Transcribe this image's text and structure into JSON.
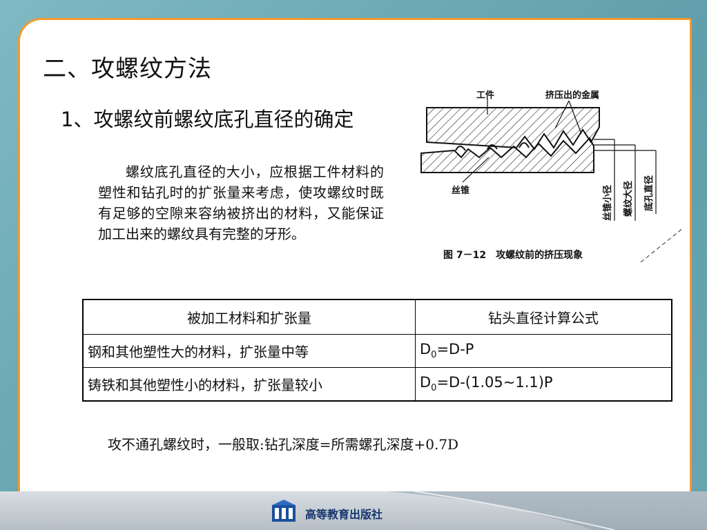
{
  "slide": {
    "title": "二、攻螺纹方法",
    "subtitle": "1、攻螺纹前螺纹底孔直径的确定",
    "paragraph": "螺纹底孔直径的大小，应根据工件材料的塑性和钻孔时的扩张量来考虑，使攻螺纹时既有足够的空隙来容纳被挤出的材料，又能保证加工出来的螺纹具有完整的牙形。",
    "note": "攻不通孔螺纹时，一般取:钻孔深度=所需螺孔深度+0.7D"
  },
  "figure": {
    "label_workpiece": "工件",
    "label_extruded": "挤压出的金属",
    "label_tap": "丝锥",
    "label_tap_minor": "丝锥小径",
    "label_thread_major": "螺纹大径",
    "label_hole": "底孔直径",
    "caption": "图 7－12　攻螺纹前的挤压现象"
  },
  "table": {
    "headers": [
      "被加工材料和扩张量",
      "钻头直径计算公式"
    ],
    "rows": [
      {
        "material": "钢和其他塑性大的材料，扩张量中等",
        "formula_main": "D",
        "formula_sub": "0",
        "formula_rest": "=D-P"
      },
      {
        "material": "铸铁和其他塑性小的材料，扩张量较小",
        "formula_main": "D",
        "formula_sub": "0",
        "formula_rest": "=D-(1.05~1.1)P"
      }
    ]
  },
  "footer": {
    "publisher": "高等教育出版社"
  },
  "colors": {
    "frame_orange": "#f29a2e",
    "background_teal": "#6aa7b3",
    "publisher_blue": "#16356e"
  }
}
